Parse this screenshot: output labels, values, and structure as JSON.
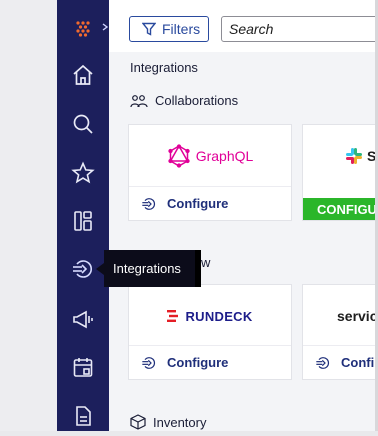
{
  "toolbar": {
    "filters_label": "Filters",
    "search_placeholder": "Search"
  },
  "main": {
    "heading": "Integrations",
    "sections": [
      {
        "title": "Collaborations",
        "icon": "people-group-icon"
      },
      {
        "title_fragment": "w"
      },
      {
        "title": "Inventory",
        "icon": "box-icon"
      }
    ]
  },
  "cards": [
    {
      "name": "GraphQL",
      "action": "Configure",
      "brand_color": "#e10098"
    },
    {
      "name": "S",
      "action": "CONFIGU",
      "brand_color": "#2bb62a"
    },
    {
      "name": "RUNDECK",
      "action": "Configure",
      "brand_color": "#e41e26"
    },
    {
      "name": "servic",
      "action": "Confi"
    }
  ],
  "sidebar": {
    "items": [
      {
        "name": "logo",
        "icon": "grid-logo-icon"
      },
      {
        "name": "home",
        "icon": "home-icon"
      },
      {
        "name": "search",
        "icon": "search-icon"
      },
      {
        "name": "favorites",
        "icon": "star-icon"
      },
      {
        "name": "dashboards",
        "icon": "layout-icon"
      },
      {
        "name": "integrations",
        "icon": "integrations-icon"
      },
      {
        "name": "announcements",
        "icon": "megaphone-icon"
      },
      {
        "name": "calendar",
        "icon": "calendar-icon"
      },
      {
        "name": "documents",
        "icon": "document-icon"
      }
    ]
  },
  "tooltip": {
    "text": "Integrations"
  },
  "colors": {
    "sidebar_bg": "#1c1f5c",
    "accent": "#2a4a9e",
    "configure_text": "#1f2f7a"
  }
}
